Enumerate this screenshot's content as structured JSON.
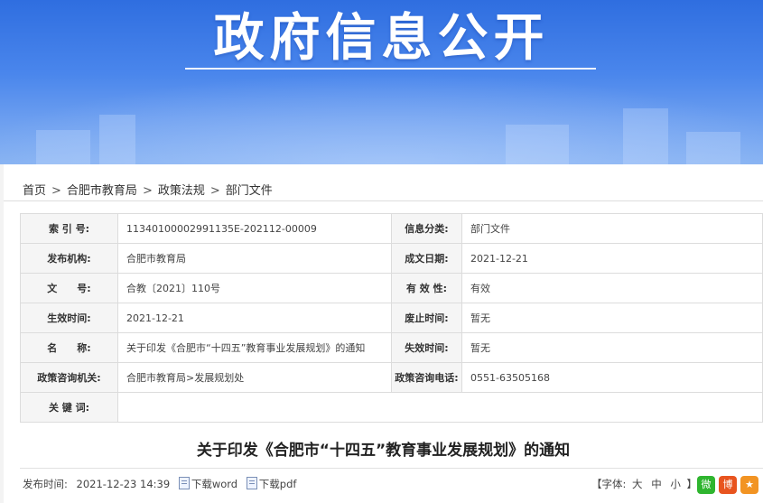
{
  "banner": {
    "title": "政府信息公开"
  },
  "breadcrumb": [
    "首页",
    "合肥市教育局",
    "政策法规",
    "部门文件"
  ],
  "breadcrumb_separator": ">",
  "meta": {
    "rows": [
      [
        {
          "label": "索 引 号:",
          "value": "11340100002991135E-202112-00009"
        },
        {
          "label": "信息分类:",
          "value": "部门文件"
        }
      ],
      [
        {
          "label": "发布机构:",
          "value": "合肥市教育局"
        },
        {
          "label": "成文日期:",
          "value": "2021-12-21"
        }
      ],
      [
        {
          "label": "文　　号:",
          "value": "合教〔2021〕110号"
        },
        {
          "label": "有 效 性:",
          "value": "有效"
        }
      ],
      [
        {
          "label": "生效时间:",
          "value": "2021-12-21"
        },
        {
          "label": "废止时间:",
          "value": "暂无"
        }
      ],
      [
        {
          "label": "名　　称:",
          "value": "关于印发《合肥市“十四五”教育事业发展规划》的通知"
        },
        {
          "label": "失效时间:",
          "value": "暂无"
        }
      ],
      [
        {
          "label": "政策咨询机关:",
          "value": "合肥市教育局>发展规划处"
        },
        {
          "label": "政策咨询电话:",
          "value": "0551-63505168"
        }
      ]
    ],
    "keywords": {
      "label": "关 键 词:",
      "value": ""
    }
  },
  "document": {
    "title": "关于印发《合肥市“十四五”教育事业发展规划》的通知"
  },
  "footer": {
    "publish_label": "发布时间:",
    "publish_time": "2021-12-23 14:39",
    "download_word": "下载word",
    "download_pdf": "下载pdf",
    "font_label": "【字体:",
    "font_large": "大",
    "font_medium": "中",
    "font_small": "小",
    "font_close": "】"
  },
  "share": [
    {
      "name": "wechat-share-icon",
      "glyph": "微",
      "color": "#2fb52f"
    },
    {
      "name": "weibo-share-icon",
      "glyph": "博",
      "color": "#e8541f"
    },
    {
      "name": "favorite-star-icon",
      "glyph": "★",
      "color": "#f29423"
    }
  ]
}
